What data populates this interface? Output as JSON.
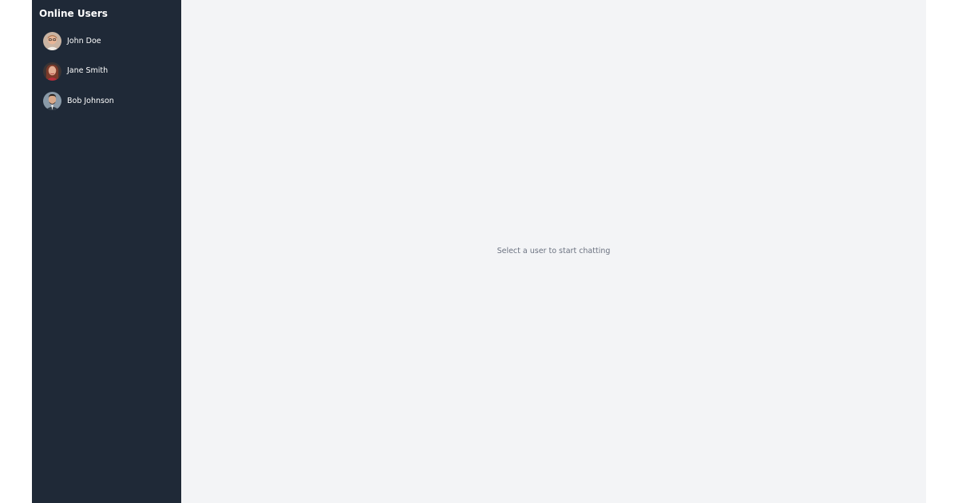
{
  "sidebar": {
    "title": "Online Users",
    "users": [
      {
        "name": "John Doe",
        "avatar_icon": "avatar-john-doe"
      },
      {
        "name": "Jane Smith",
        "avatar_icon": "avatar-jane-smith"
      },
      {
        "name": "Bob Johnson",
        "avatar_icon": "avatar-bob-johnson"
      }
    ]
  },
  "main": {
    "empty_message": "Select a user to start chatting"
  },
  "colors": {
    "sidebar_bg": "#1f2937",
    "main_bg": "#f3f4f6",
    "text_light": "#ffffff",
    "text_muted": "#6b7280"
  }
}
